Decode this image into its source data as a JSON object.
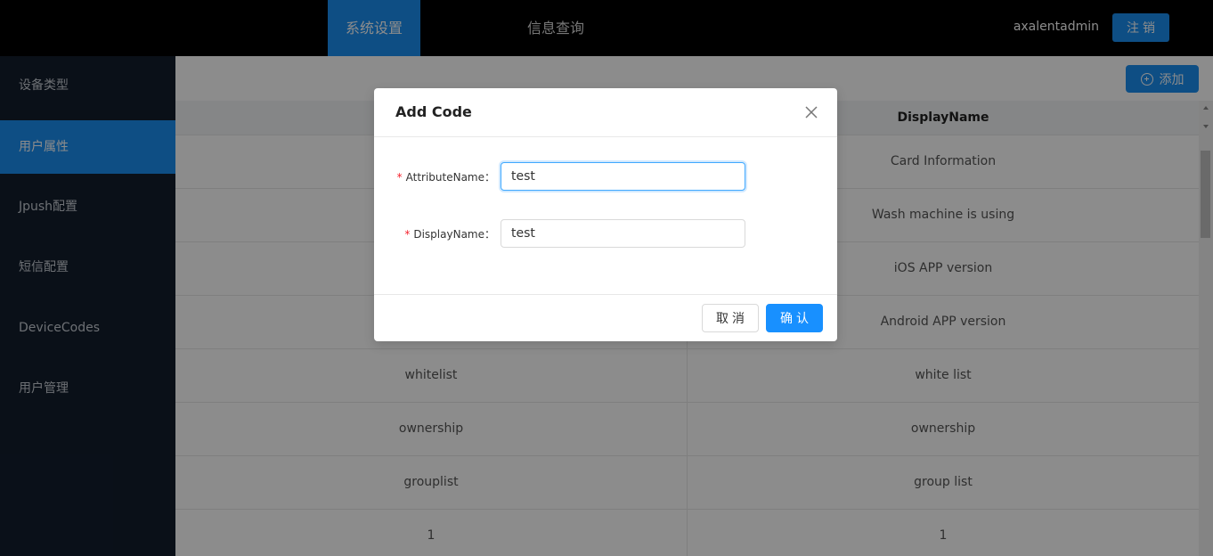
{
  "header": {
    "tabs": [
      {
        "label": "系统设置",
        "active": true
      },
      {
        "label": "信息查询",
        "active": false
      }
    ],
    "username": "axalentadmin",
    "logout_label": "注销"
  },
  "sidebar": {
    "items": [
      {
        "label": "设备类型",
        "active": false
      },
      {
        "label": "用户属性",
        "active": true
      },
      {
        "label": "Jpush配置",
        "active": false
      },
      {
        "label": "短信配置",
        "active": false
      },
      {
        "label": "DeviceCodes",
        "active": false
      },
      {
        "label": "用户管理",
        "active": false
      }
    ]
  },
  "toolbar": {
    "add_label": "添加",
    "add_icon": "plus-circle-icon"
  },
  "table": {
    "columns": [
      "",
      "DisplayName"
    ],
    "rows": [
      [
        "",
        "Card Information"
      ],
      [
        "",
        "Wash machine is using"
      ],
      [
        "",
        "iOS APP version"
      ],
      [
        "",
        "Android APP version"
      ],
      [
        "whitelist",
        "white list"
      ],
      [
        "ownership",
        "ownership"
      ],
      [
        "grouplist",
        "group list"
      ],
      [
        "1",
        "1"
      ]
    ]
  },
  "modal": {
    "title": "Add Code",
    "fields": [
      {
        "label": "AttributeName：",
        "required": true,
        "value": "test"
      },
      {
        "label": "DisplayName：",
        "required": true,
        "value": "test"
      }
    ],
    "cancel_label": "取消",
    "ok_label": "确认"
  },
  "colors": {
    "accent": "#1b8ef0",
    "sidebar_bg": "#131e2d",
    "header_bg": "#000000",
    "required_mark": "#f5222d"
  }
}
